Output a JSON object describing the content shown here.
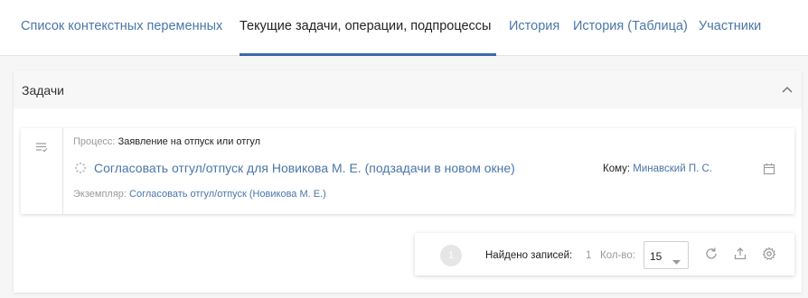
{
  "tabs": [
    {
      "label": "Список контекстных переменных",
      "active": false
    },
    {
      "label": "Текущие задачи, операции, подпроцессы",
      "active": true
    },
    {
      "label": "История",
      "active": false
    },
    {
      "label": "История (Таблица)",
      "active": false
    },
    {
      "label": "Участники",
      "active": false
    }
  ],
  "panel": {
    "title": "Задачи",
    "collapse_icon": "chevron-up-icon"
  },
  "task": {
    "process_label": "Процесс:",
    "process_value": "Заявление на отпуск или отгул",
    "title": "Согласовать отгул/отпуск для Новикова М. Е. (подзадачи в новом окне)",
    "instance_label": "Экземпляр:",
    "instance_value": "Согласовать отгул/отпуск (Новикова М. Е.)",
    "assignee_label": "Кому:",
    "assignee_value": "Минавский П. С.",
    "icons": [
      "list-check-icon",
      "spinner-icon",
      "calendar-icon"
    ]
  },
  "pager": {
    "page": "1",
    "records_label": "Найдено записей:",
    "records_count": "1",
    "count_label": "Кол-во:",
    "page_size": "15",
    "icons": [
      "refresh-icon",
      "export-icon",
      "settings-icon"
    ]
  },
  "colors": {
    "link": "#4a76a8",
    "active_tab_underline": "#3a6aa7",
    "muted_text": "#9a9a9a"
  }
}
